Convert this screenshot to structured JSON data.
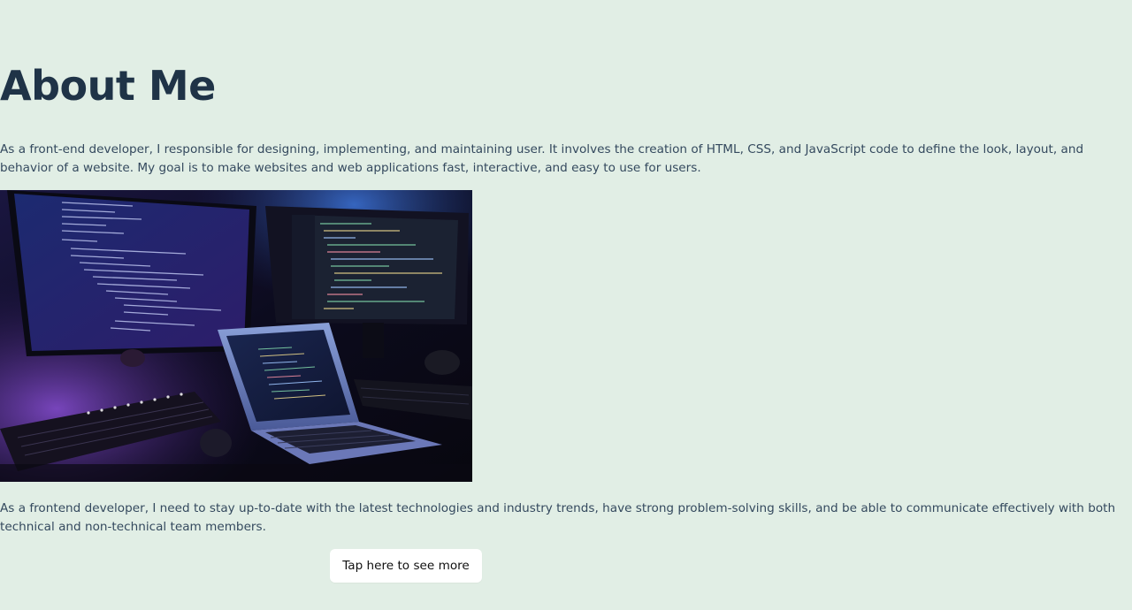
{
  "about": {
    "heading": "About Me",
    "paragraph_1": "As a front-end developer, I responsible for designing, implementing, and maintaining user. It involves the creation of HTML, CSS, and JavaScript code to define the look, layout, and behavior of a website. My goal is to make websites and web applications fast, interactive, and easy to use for users.",
    "paragraph_2": "As a frontend developer, I need to stay up-to-date with the latest technologies and industry trends, have strong problem-solving skills, and be able to communicate effectively with both technical and non-technical team members.",
    "button_label": "Tap here to see more"
  },
  "colors": {
    "background": "#e1eee5",
    "heading": "#1f3347",
    "body_text": "#34495e",
    "button_bg": "#ffffff"
  },
  "image": {
    "subject": "developer workstation photo with monitors and laptop showing code"
  }
}
